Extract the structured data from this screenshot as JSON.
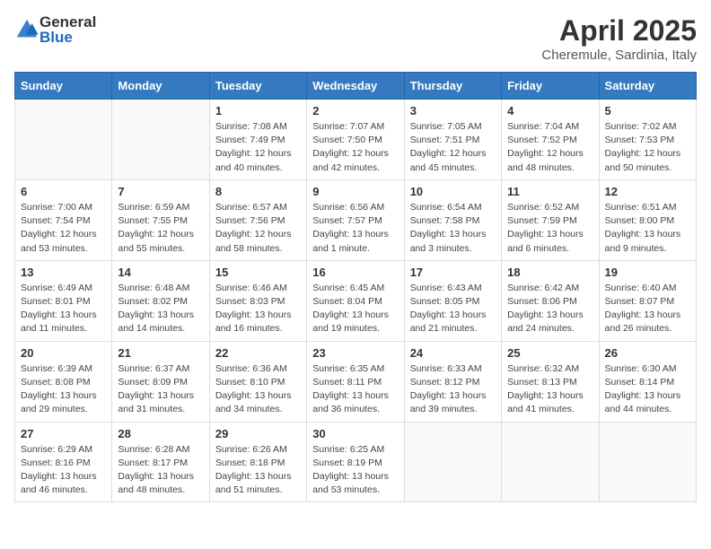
{
  "header": {
    "logo_general": "General",
    "logo_blue": "Blue",
    "month_title": "April 2025",
    "location": "Cheremule, Sardinia, Italy"
  },
  "weekdays": [
    "Sunday",
    "Monday",
    "Tuesday",
    "Wednesday",
    "Thursday",
    "Friday",
    "Saturday"
  ],
  "weeks": [
    [
      {
        "day": "",
        "info": ""
      },
      {
        "day": "",
        "info": ""
      },
      {
        "day": "1",
        "info": "Sunrise: 7:08 AM\nSunset: 7:49 PM\nDaylight: 12 hours and 40 minutes."
      },
      {
        "day": "2",
        "info": "Sunrise: 7:07 AM\nSunset: 7:50 PM\nDaylight: 12 hours and 42 minutes."
      },
      {
        "day": "3",
        "info": "Sunrise: 7:05 AM\nSunset: 7:51 PM\nDaylight: 12 hours and 45 minutes."
      },
      {
        "day": "4",
        "info": "Sunrise: 7:04 AM\nSunset: 7:52 PM\nDaylight: 12 hours and 48 minutes."
      },
      {
        "day": "5",
        "info": "Sunrise: 7:02 AM\nSunset: 7:53 PM\nDaylight: 12 hours and 50 minutes."
      }
    ],
    [
      {
        "day": "6",
        "info": "Sunrise: 7:00 AM\nSunset: 7:54 PM\nDaylight: 12 hours and 53 minutes."
      },
      {
        "day": "7",
        "info": "Sunrise: 6:59 AM\nSunset: 7:55 PM\nDaylight: 12 hours and 55 minutes."
      },
      {
        "day": "8",
        "info": "Sunrise: 6:57 AM\nSunset: 7:56 PM\nDaylight: 12 hours and 58 minutes."
      },
      {
        "day": "9",
        "info": "Sunrise: 6:56 AM\nSunset: 7:57 PM\nDaylight: 13 hours and 1 minute."
      },
      {
        "day": "10",
        "info": "Sunrise: 6:54 AM\nSunset: 7:58 PM\nDaylight: 13 hours and 3 minutes."
      },
      {
        "day": "11",
        "info": "Sunrise: 6:52 AM\nSunset: 7:59 PM\nDaylight: 13 hours and 6 minutes."
      },
      {
        "day": "12",
        "info": "Sunrise: 6:51 AM\nSunset: 8:00 PM\nDaylight: 13 hours and 9 minutes."
      }
    ],
    [
      {
        "day": "13",
        "info": "Sunrise: 6:49 AM\nSunset: 8:01 PM\nDaylight: 13 hours and 11 minutes."
      },
      {
        "day": "14",
        "info": "Sunrise: 6:48 AM\nSunset: 8:02 PM\nDaylight: 13 hours and 14 minutes."
      },
      {
        "day": "15",
        "info": "Sunrise: 6:46 AM\nSunset: 8:03 PM\nDaylight: 13 hours and 16 minutes."
      },
      {
        "day": "16",
        "info": "Sunrise: 6:45 AM\nSunset: 8:04 PM\nDaylight: 13 hours and 19 minutes."
      },
      {
        "day": "17",
        "info": "Sunrise: 6:43 AM\nSunset: 8:05 PM\nDaylight: 13 hours and 21 minutes."
      },
      {
        "day": "18",
        "info": "Sunrise: 6:42 AM\nSunset: 8:06 PM\nDaylight: 13 hours and 24 minutes."
      },
      {
        "day": "19",
        "info": "Sunrise: 6:40 AM\nSunset: 8:07 PM\nDaylight: 13 hours and 26 minutes."
      }
    ],
    [
      {
        "day": "20",
        "info": "Sunrise: 6:39 AM\nSunset: 8:08 PM\nDaylight: 13 hours and 29 minutes."
      },
      {
        "day": "21",
        "info": "Sunrise: 6:37 AM\nSunset: 8:09 PM\nDaylight: 13 hours and 31 minutes."
      },
      {
        "day": "22",
        "info": "Sunrise: 6:36 AM\nSunset: 8:10 PM\nDaylight: 13 hours and 34 minutes."
      },
      {
        "day": "23",
        "info": "Sunrise: 6:35 AM\nSunset: 8:11 PM\nDaylight: 13 hours and 36 minutes."
      },
      {
        "day": "24",
        "info": "Sunrise: 6:33 AM\nSunset: 8:12 PM\nDaylight: 13 hours and 39 minutes."
      },
      {
        "day": "25",
        "info": "Sunrise: 6:32 AM\nSunset: 8:13 PM\nDaylight: 13 hours and 41 minutes."
      },
      {
        "day": "26",
        "info": "Sunrise: 6:30 AM\nSunset: 8:14 PM\nDaylight: 13 hours and 44 minutes."
      }
    ],
    [
      {
        "day": "27",
        "info": "Sunrise: 6:29 AM\nSunset: 8:16 PM\nDaylight: 13 hours and 46 minutes."
      },
      {
        "day": "28",
        "info": "Sunrise: 6:28 AM\nSunset: 8:17 PM\nDaylight: 13 hours and 48 minutes."
      },
      {
        "day": "29",
        "info": "Sunrise: 6:26 AM\nSunset: 8:18 PM\nDaylight: 13 hours and 51 minutes."
      },
      {
        "day": "30",
        "info": "Sunrise: 6:25 AM\nSunset: 8:19 PM\nDaylight: 13 hours and 53 minutes."
      },
      {
        "day": "",
        "info": ""
      },
      {
        "day": "",
        "info": ""
      },
      {
        "day": "",
        "info": ""
      }
    ]
  ]
}
